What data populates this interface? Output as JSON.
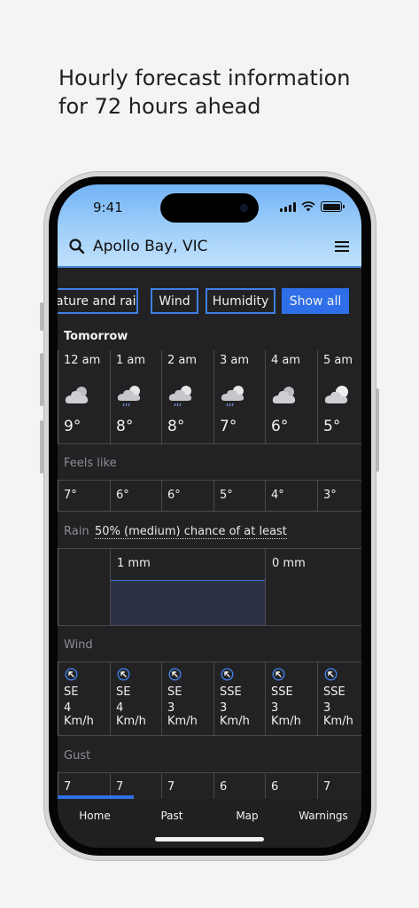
{
  "headline": {
    "line1": "Hourly forecast information",
    "line2": "for 72 hours ahead"
  },
  "status_bar": {
    "time": "9:41"
  },
  "header": {
    "location": "Apollo Bay, VIC"
  },
  "filters": [
    {
      "label": "ature and rain"
    },
    {
      "label": "Wind"
    },
    {
      "label": "Humidity"
    },
    {
      "label": "Show all",
      "active": true
    }
  ],
  "forecast": {
    "day": "Tomorrow",
    "hours": [
      {
        "time": "12 am",
        "icon": "cloudy-icon",
        "temp": "9°",
        "feels": "7°",
        "wind_dir": "SE",
        "wind_speed": "4",
        "wind_unit": "Km/h",
        "gust": "7"
      },
      {
        "time": "1 am",
        "icon": "partly-cloudy-showers-icon",
        "temp": "8°",
        "feels": "6°",
        "wind_dir": "SE",
        "wind_speed": "4",
        "wind_unit": "Km/h",
        "gust": "7"
      },
      {
        "time": "2 am",
        "icon": "partly-cloudy-showers-icon",
        "temp": "8°",
        "feels": "6°",
        "wind_dir": "SE",
        "wind_speed": "3",
        "wind_unit": "Km/h",
        "gust": "7"
      },
      {
        "time": "3 am",
        "icon": "partly-cloudy-showers-icon",
        "temp": "7°",
        "feels": "5°",
        "wind_dir": "SSE",
        "wind_speed": "3",
        "wind_unit": "Km/h",
        "gust": "6"
      },
      {
        "time": "4 am",
        "icon": "cloudy-icon",
        "temp": "6°",
        "feels": "4°",
        "wind_dir": "SSE",
        "wind_speed": "3",
        "wind_unit": "Km/h",
        "gust": "6"
      },
      {
        "time": "5 am",
        "icon": "partly-cloudy-icon",
        "temp": "5°",
        "feels": "3°",
        "wind_dir": "SSE",
        "wind_speed": "3",
        "wind_unit": "Km/h",
        "gust": "7"
      }
    ],
    "feels_label": "Feels like",
    "rain_label": "Rain",
    "rain_chance": "50% (medium) chance of at least",
    "rain_amounts": [
      "1 mm",
      "0 mm"
    ],
    "wind_label": "Wind",
    "gust_label": "Gust"
  },
  "nav": {
    "home": "Home",
    "past": "Past",
    "map": "Map",
    "warnings": "Warnings"
  },
  "colors": {
    "accent": "#2e6ee8",
    "background": "#222224",
    "sky": "#8ec5f7"
  }
}
